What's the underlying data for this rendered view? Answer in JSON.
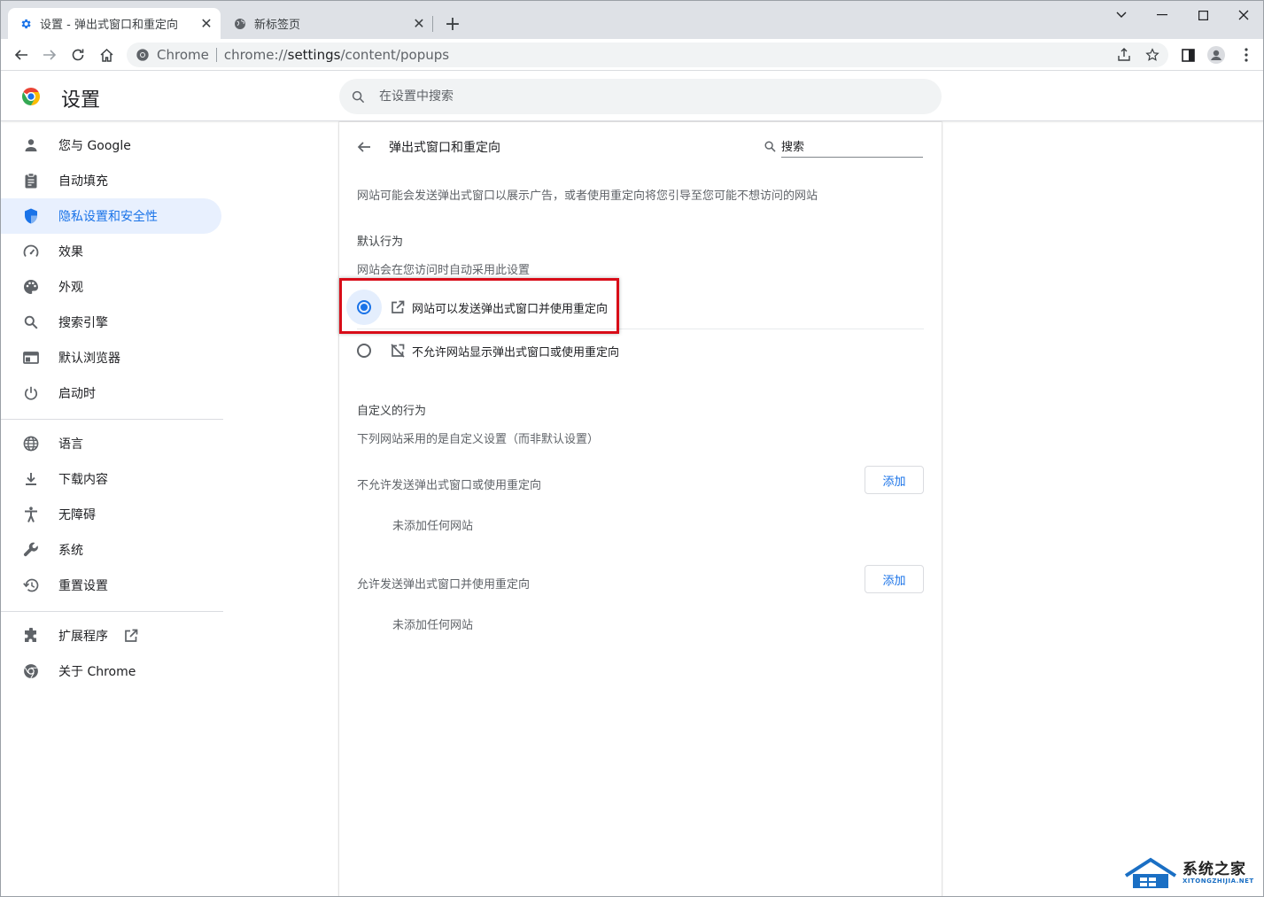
{
  "browser": {
    "tabs": [
      {
        "title": "设置 - 弹出式窗口和重定向",
        "active": true,
        "icon": "gear-icon"
      },
      {
        "title": "新标签页",
        "active": false,
        "icon": "globe-icon"
      }
    ],
    "omnibox": {
      "chip": "Chrome",
      "url_scheme": "chrome://",
      "url_host": "settings",
      "url_path": "/content/popups"
    }
  },
  "settings": {
    "title": "设置",
    "search_placeholder": "在设置中搜索"
  },
  "sidebar": {
    "items": [
      {
        "label": "您与 Google",
        "icon": "person-icon"
      },
      {
        "label": "自动填充",
        "icon": "clipboard-icon"
      },
      {
        "label": "隐私设置和安全性",
        "icon": "shield-icon",
        "selected": true
      },
      {
        "label": "效果",
        "icon": "speedometer-icon"
      },
      {
        "label": "外观",
        "icon": "palette-icon"
      },
      {
        "label": "搜索引擎",
        "icon": "search-icon"
      },
      {
        "label": "默认浏览器",
        "icon": "browser-icon"
      },
      {
        "label": "启动时",
        "icon": "power-icon"
      },
      {
        "label": "语言",
        "icon": "globe-icon"
      },
      {
        "label": "下载内容",
        "icon": "download-icon"
      },
      {
        "label": "无障碍",
        "icon": "accessibility-icon"
      },
      {
        "label": "系统",
        "icon": "wrench-icon"
      },
      {
        "label": "重置设置",
        "icon": "restore-icon"
      },
      {
        "label": "扩展程序",
        "icon": "puzzle-icon"
      },
      {
        "label": "关于 Chrome",
        "icon": "chrome-icon"
      }
    ]
  },
  "page": {
    "title": "弹出式窗口和重定向",
    "search_placeholder": "搜索",
    "description": "网站可能会发送弹出式窗口以展示广告，或者使用重定向将您引导至您可能不想访问的网站",
    "default_heading": "默认行为",
    "default_sub": "网站会在您访问时自动采用此设置",
    "options": [
      {
        "label": "网站可以发送弹出式窗口并使用重定向",
        "checked": true,
        "icon": "open-in-new-icon"
      },
      {
        "label": "不允许网站显示弹出式窗口或使用重定向",
        "checked": false,
        "icon": "popup-blocked-icon"
      }
    ],
    "custom_heading": "自定义的行为",
    "custom_sub": "下列网站采用的是自定义设置（而非默认设置）",
    "block_list": {
      "label": "不允许发送弹出式窗口或使用重定向",
      "add": "添加",
      "empty": "未添加任何网站"
    },
    "allow_list": {
      "label": "允许发送弹出式窗口并使用重定向",
      "add": "添加",
      "empty": "未添加任何网站"
    }
  },
  "watermark": {
    "name": "系统之家",
    "domain": "XITONGZHIJIA.NET"
  },
  "colors": {
    "accent": "#1a73e8",
    "highlight": "#d80c18",
    "selected_bg": "#e8f0fe"
  }
}
